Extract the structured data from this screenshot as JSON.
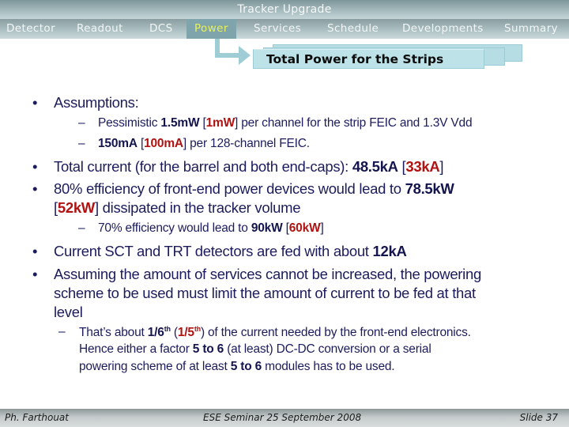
{
  "header": {
    "title": "Tracker Upgrade"
  },
  "nav": {
    "items": [
      {
        "label": "Detector",
        "active": false
      },
      {
        "label": "Readout",
        "active": false
      },
      {
        "label": "DCS",
        "active": false
      },
      {
        "label": "Power",
        "active": true
      },
      {
        "label": "Services",
        "active": false
      },
      {
        "label": "Schedule",
        "active": false
      },
      {
        "label": "Developments",
        "active": false
      },
      {
        "label": "Summary",
        "active": false
      }
    ]
  },
  "slide_tab": {
    "title": "Total Power for the Strips"
  },
  "colors": {
    "text": "#1c1c5c",
    "highlight_red": "#b01212",
    "active_nav": "#e8f25a",
    "tab_fill": "#bde2e8"
  },
  "body": {
    "b1": {
      "text": "Assumptions:"
    },
    "b1_s1": {
      "t1": "Pessimistic ",
      "v1": "1.5mW",
      "t2": " [",
      "v2": "1mW",
      "t3": "] per channel for the strip FEIC and 1.3V Vdd"
    },
    "b1_s2": {
      "v1": "150mA",
      "t1": " [",
      "v2": "100mA",
      "t2": "] per 128-channel FEIC."
    },
    "b2": {
      "t1": "Total current (for the barrel and both end-caps): ",
      "v1": "48.5kA",
      "t2": " [",
      "v2": "33kA",
      "t3": "]"
    },
    "b3": {
      "t1": "80% efficiency of front-end power devices would lead to ",
      "v1": "78.5kW",
      "t2": "[",
      "v2": "52kW",
      "t3": "] dissipated in the tracker volume"
    },
    "b3_s1": {
      "t1": "70% efficiency would lead to ",
      "v1": "90kW",
      "t2": " [",
      "v2": "60kW",
      "t3": "]"
    },
    "b4": {
      "t1": "Current SCT and TRT detectors are fed with about ",
      "v1": "12kA"
    },
    "b5": {
      "line1": "Assuming the amount of services cannot be increased, the powering",
      "line2": "scheme to be used must limit the amount of current to be fed at that",
      "line3": "level"
    },
    "b5_s1": {
      "t1": "That’s about  ",
      "v1": "1/6",
      "v1_sup": "th",
      "t2": " (",
      "v2": "1/5",
      "v2_sup": "th",
      "t3": ") of the current needed by the front-end electronics.",
      "l2_t1": "Hence either a factor ",
      "l2_v1": "5 to 6",
      "l2_t2": " (at least) DC-DC conversion or a serial",
      "l3_t1": "powering scheme of at least ",
      "l3_v1": "5 to 6",
      "l3_t2": " modules has to be used."
    },
    "bullet_char": "•",
    "dash_char": "–"
  },
  "footer": {
    "author": "Ph. Farthouat",
    "event": "ESE Seminar 25 September 2008",
    "slide": "Slide 37"
  }
}
